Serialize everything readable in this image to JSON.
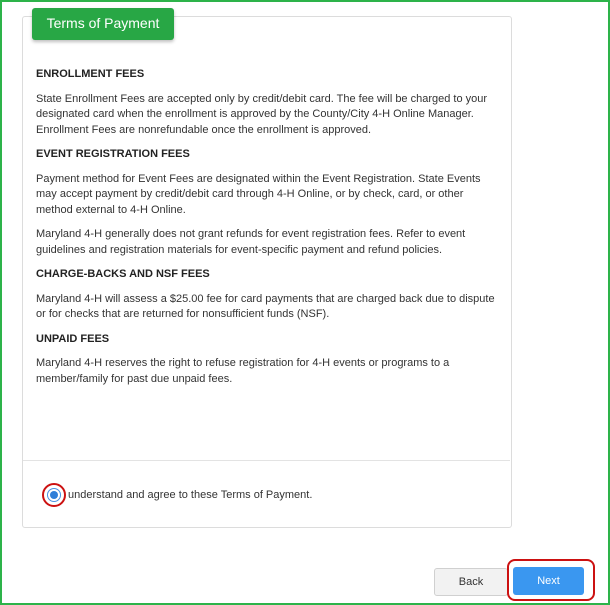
{
  "header": {
    "title": "Terms of Payment"
  },
  "sections": [
    {
      "title": "ENROLLMENT FEES",
      "paragraphs": [
        "State Enrollment Fees are accepted only by credit/debit card.  The fee will be charged to your designated card when the enrollment is approved by the County/City 4-H Online Manager.  Enrollment Fees are nonrefundable once the enrollment is approved."
      ]
    },
    {
      "title": "EVENT REGISTRATION FEES",
      "paragraphs": [
        "Payment method for Event Fees are designated within the Event Registration.  State Events may accept payment by credit/debit card through 4-H Online, or by check, card, or other method external to 4-H Online.",
        "Maryland 4-H generally does not grant refunds for event registration fees.  Refer to event guidelines and registration materials for event-specific payment and refund policies."
      ]
    },
    {
      "title": "CHARGE-BACKS AND NSF FEES",
      "paragraphs": [
        "Maryland 4-H will assess a $25.00 fee for card payments that are charged back due to dispute or for checks that are returned for nonsufficient funds (NSF)."
      ]
    },
    {
      "title": "UNPAID FEES",
      "paragraphs": [
        "Maryland 4-H reserves the right to refuse registration for 4-H events or programs to a member/family for past due unpaid fees."
      ]
    }
  ],
  "agreement": {
    "label": "understand and agree to these Terms of Payment.",
    "checked": true
  },
  "buttons": {
    "back": "Back",
    "next": "Next"
  },
  "colors": {
    "accent_green": "#28a745",
    "frame_border": "#2db34a",
    "next_blue": "#3a97f0",
    "highlight_red": "#cc1111"
  }
}
